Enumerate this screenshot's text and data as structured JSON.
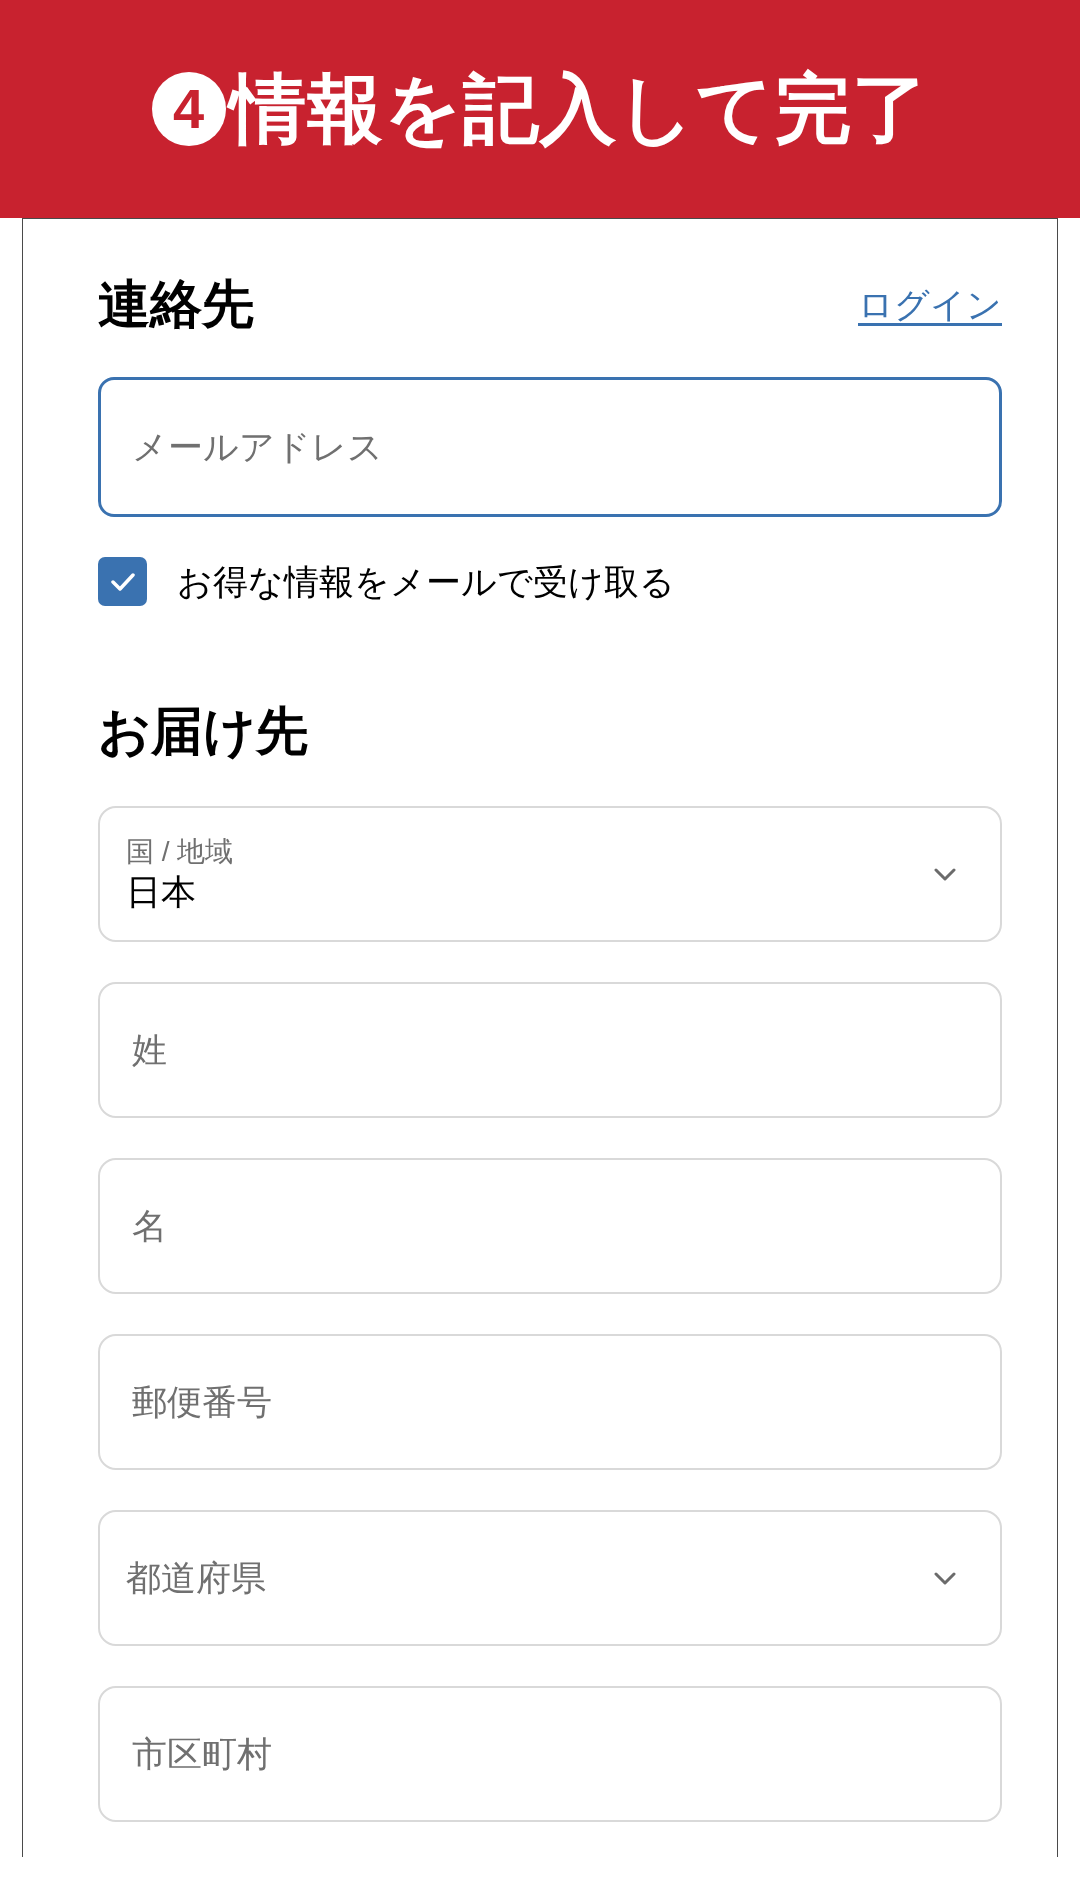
{
  "banner": {
    "step_number": "4",
    "title": "情報を記入して完了"
  },
  "contact": {
    "heading": "連絡先",
    "login_link": "ログイン",
    "email_field": {
      "placeholder": "メールアドレス",
      "focused": true
    },
    "newsletter": {
      "label": "お得な情報をメールで受け取る",
      "checked": true
    }
  },
  "shipping": {
    "heading": "お届け先",
    "fields": [
      {
        "kind": "select",
        "label": "国 / 地域",
        "value": "日本"
      },
      {
        "kind": "text",
        "placeholder": "姓"
      },
      {
        "kind": "text",
        "placeholder": "名"
      },
      {
        "kind": "text",
        "placeholder": "郵便番号"
      },
      {
        "kind": "select",
        "placeholder": "都道府県"
      },
      {
        "kind": "text",
        "placeholder": "市区町村"
      }
    ]
  }
}
